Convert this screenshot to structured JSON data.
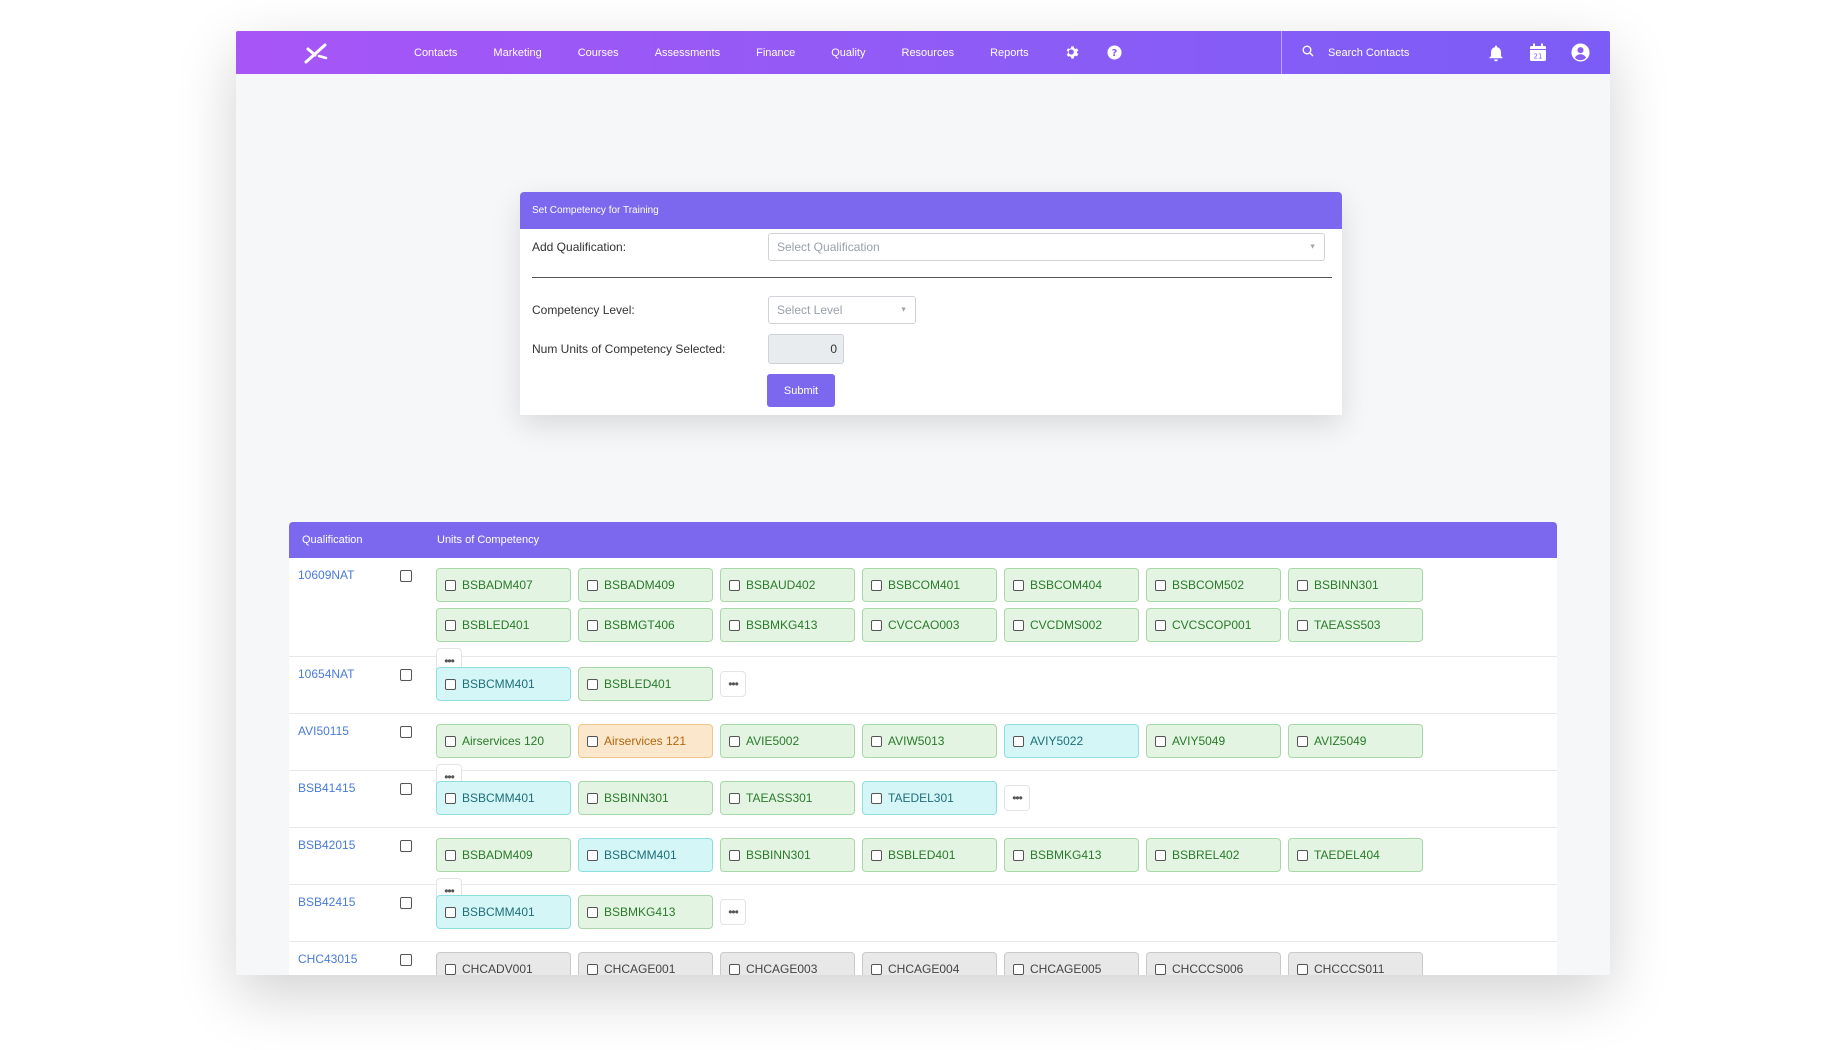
{
  "nav": {
    "items": [
      "Contacts",
      "Marketing",
      "Courses",
      "Assessments",
      "Finance",
      "Quality",
      "Resources",
      "Reports"
    ],
    "search_placeholder": "Search Contacts",
    "calendar_day": "21"
  },
  "form": {
    "title": "Set Competency for Training",
    "add_qualification_label": "Add Qualification:",
    "qualification_placeholder": "Select Qualification",
    "competency_level_label": "Competency Level:",
    "level_placeholder": "Select Level",
    "num_units_label": "Num Units of Competency Selected:",
    "num_units_value": "0",
    "submit_label": "Submit"
  },
  "table": {
    "headers": [
      "Qualification",
      "Units of Competency"
    ],
    "rows": [
      {
        "code": "10609NAT",
        "units": [
          {
            "label": "BSBADM407",
            "color": "green"
          },
          {
            "label": "BSBADM409",
            "color": "green"
          },
          {
            "label": "BSBAUD402",
            "color": "green"
          },
          {
            "label": "BSBCOM401",
            "color": "green"
          },
          {
            "label": "BSBCOM404",
            "color": "green"
          },
          {
            "label": "BSBCOM502",
            "color": "green"
          },
          {
            "label": "BSBINN301",
            "color": "green"
          },
          {
            "label": "BSBLED401",
            "color": "green"
          },
          {
            "label": "BSBMGT406",
            "color": "green"
          },
          {
            "label": "BSBMKG413",
            "color": "green"
          },
          {
            "label": "CVCCAO003",
            "color": "green"
          },
          {
            "label": "CVCDMS002",
            "color": "green"
          },
          {
            "label": "CVCSCOP001",
            "color": "green"
          },
          {
            "label": "TAEASS503",
            "color": "green"
          }
        ]
      },
      {
        "code": "10654NAT",
        "units": [
          {
            "label": "BSBCMM401",
            "color": "cyan"
          },
          {
            "label": "BSBLED401",
            "color": "green"
          }
        ]
      },
      {
        "code": "AVI50115",
        "units": [
          {
            "label": "Airservices 120",
            "color": "green"
          },
          {
            "label": "Airservices 121",
            "color": "orange"
          },
          {
            "label": "AVIE5002",
            "color": "green"
          },
          {
            "label": "AVIW5013",
            "color": "green"
          },
          {
            "label": "AVIY5022",
            "color": "cyan"
          },
          {
            "label": "AVIY5049",
            "color": "green"
          },
          {
            "label": "AVIZ5049",
            "color": "green"
          }
        ]
      },
      {
        "code": "BSB41415",
        "units": [
          {
            "label": "BSBCMM401",
            "color": "cyan"
          },
          {
            "label": "BSBINN301",
            "color": "green"
          },
          {
            "label": "TAEASS301",
            "color": "green"
          },
          {
            "label": "TAEDEL301",
            "color": "cyan"
          }
        ]
      },
      {
        "code": "BSB42015",
        "units": [
          {
            "label": "BSBADM409",
            "color": "green"
          },
          {
            "label": "BSBCMM401",
            "color": "cyan"
          },
          {
            "label": "BSBINN301",
            "color": "green"
          },
          {
            "label": "BSBLED401",
            "color": "green"
          },
          {
            "label": "BSBMKG413",
            "color": "green"
          },
          {
            "label": "BSBREL402",
            "color": "green"
          },
          {
            "label": "TAEDEL404",
            "color": "green"
          }
        ]
      },
      {
        "code": "BSB42415",
        "units": [
          {
            "label": "BSBCMM401",
            "color": "cyan"
          },
          {
            "label": "BSBMKG413",
            "color": "green"
          }
        ]
      },
      {
        "code": "CHC43015",
        "units": [
          {
            "label": "CHCADV001",
            "color": "grey"
          },
          {
            "label": "CHCAGE001",
            "color": "grey"
          },
          {
            "label": "CHCAGE003",
            "color": "grey"
          },
          {
            "label": "CHCAGE004",
            "color": "grey"
          },
          {
            "label": "CHCAGE005",
            "color": "grey"
          },
          {
            "label": "CHCCCS006",
            "color": "grey"
          },
          {
            "label": "CHCCCS011",
            "color": "grey"
          }
        ]
      }
    ]
  },
  "colors": {
    "accent": "#7b68ee",
    "nav_gradient_start": "#a855f7",
    "link": "#4a7bd8"
  }
}
